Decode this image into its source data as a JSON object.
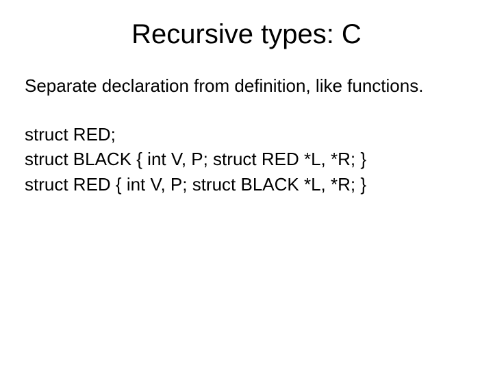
{
  "title": "Recursive types: C",
  "paragraph": "Separate declaration from definition, like functions.",
  "code": {
    "line1": "struct RED;",
    "line2": "struct BLACK { int V, P; struct RED *L, *R; }",
    "line3": "struct RED { int V, P; struct BLACK *L, *R; }"
  }
}
